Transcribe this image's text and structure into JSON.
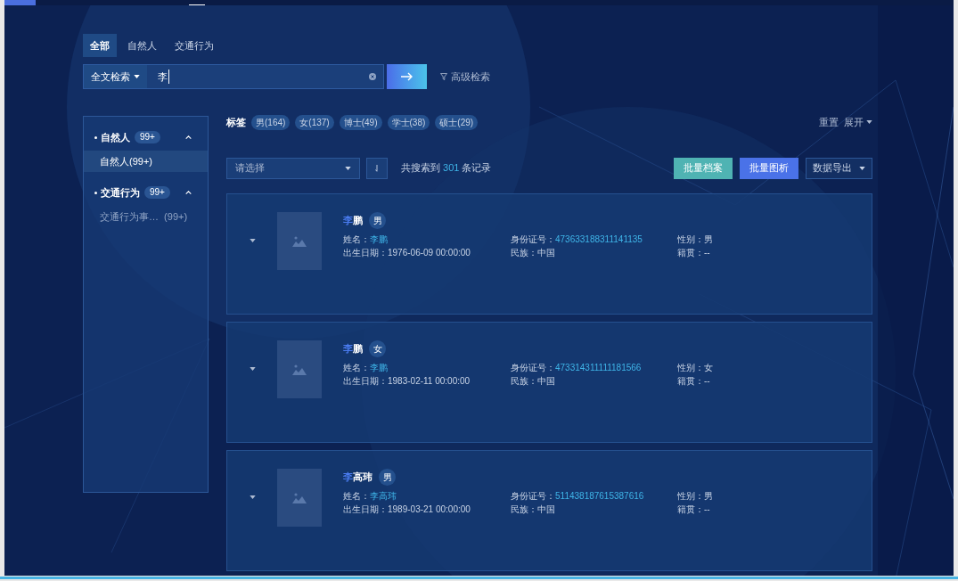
{
  "tabs": [
    {
      "label": "全部",
      "selected": true
    },
    {
      "label": "自然人",
      "selected": false
    },
    {
      "label": "交通行为",
      "selected": false
    }
  ],
  "search": {
    "mode": "全文检索",
    "value": "李",
    "advanced": "高级检索"
  },
  "sidebar": {
    "groups": [
      {
        "label": "自然人",
        "count": "99+",
        "expanded": true,
        "children": [
          {
            "label": "自然人(99+)",
            "selected": true
          }
        ]
      },
      {
        "label": "交通行为",
        "count": "99+",
        "expanded": true,
        "children": [
          {
            "label": "交通行为事…  (99+)",
            "selected": false
          }
        ]
      }
    ]
  },
  "tags": {
    "label": "标签",
    "items": [
      "男(164)",
      "女(137)",
      "博士(49)",
      "学士(38)",
      "硕士(29)"
    ],
    "reset": "重置",
    "expand": "展开"
  },
  "toolbar": {
    "select_placeholder": "请选择",
    "count_prefix": "共搜索到",
    "count": "301",
    "count_suffix": "条记录",
    "buttons": [
      {
        "label": "批量档案",
        "kind": "teal"
      },
      {
        "label": "批量图析",
        "kind": "blue"
      },
      {
        "label": "数据导出",
        "kind": "dropdown"
      }
    ]
  },
  "results": [
    {
      "name_parts": [
        {
          "text": "李",
          "match": true
        },
        {
          "text": "鹏",
          "match": false
        }
      ],
      "gender_badge": "男",
      "fields": [
        {
          "label": "姓名：",
          "value": "李鹏",
          "link": true
        },
        {
          "label": "身份证号：",
          "value": "473633188311141135",
          "link": true
        },
        {
          "label": "性别：",
          "value": "男",
          "link": false
        },
        {
          "label": "出生日期：",
          "value": "1976-06-09 00:00:00",
          "link": false
        },
        {
          "label": "民族：",
          "value": "中国",
          "link": false
        },
        {
          "label": "籍贯：",
          "value": "--",
          "link": false
        }
      ]
    },
    {
      "name_parts": [
        {
          "text": "李",
          "match": true
        },
        {
          "text": "鹏",
          "match": false
        }
      ],
      "gender_badge": "女",
      "fields": [
        {
          "label": "姓名：",
          "value": "李鹏",
          "link": true
        },
        {
          "label": "身份证号：",
          "value": "473314311111181566",
          "link": true
        },
        {
          "label": "性别：",
          "value": "女",
          "link": false
        },
        {
          "label": "出生日期：",
          "value": "1983-02-11 00:00:00",
          "link": false
        },
        {
          "label": "民族：",
          "value": "中国",
          "link": false
        },
        {
          "label": "籍贯：",
          "value": "--",
          "link": false
        }
      ]
    },
    {
      "name_parts": [
        {
          "text": "李",
          "match": true
        },
        {
          "text": "高玮",
          "match": false
        }
      ],
      "gender_badge": "男",
      "fields": [
        {
          "label": "姓名：",
          "value": "李高玮",
          "link": true
        },
        {
          "label": "身份证号：",
          "value": "511438187615387616",
          "link": true
        },
        {
          "label": "性别：",
          "value": "男",
          "link": false
        },
        {
          "label": "出生日期：",
          "value": "1989-03-21 00:00:00",
          "link": false
        },
        {
          "label": "民族：",
          "value": "中国",
          "link": false
        },
        {
          "label": "籍贯：",
          "value": "--",
          "link": false
        }
      ]
    }
  ]
}
